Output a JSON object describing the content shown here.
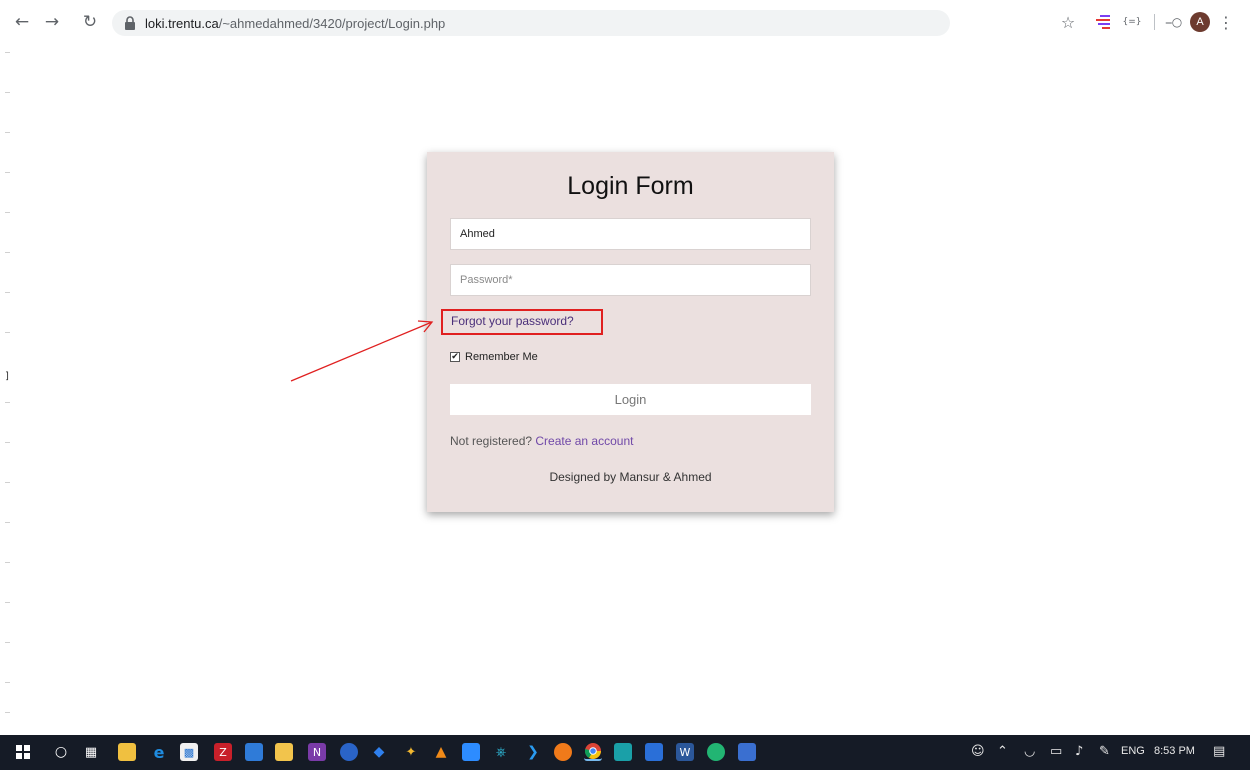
{
  "browser": {
    "url_host": "loki.trentu.ca",
    "url_path": "/~ahmedahmed/3420/project/Login.php",
    "avatar_letter": "A"
  },
  "form": {
    "title": "Login Form",
    "username_value": "Ahmed",
    "password_placeholder": "Password*",
    "forgot_link": "Forgot your password?",
    "remember_label": "Remember Me",
    "remember_checked": true,
    "login_button": "Login",
    "register_prefix": "Not registered?",
    "register_link": "Create an account",
    "footer": "Designed by Mansur & Ahmed"
  },
  "annotation": {
    "highlight_color": "#e02020",
    "target": "forgot-password-link"
  },
  "taskbar": {
    "language": "ENG",
    "time": "8:53 PM",
    "apps": [
      "windows-start",
      "search-cortana",
      "task-view",
      "file-explorer",
      "edge",
      "store",
      "filezilla",
      "sticky-notes",
      "paint",
      "onenote",
      "app-blue",
      "sourcetree",
      "app-bird",
      "vlc",
      "zoom",
      "app-network",
      "vscode",
      "firefox",
      "chrome",
      "app-teal",
      "app-chat",
      "word",
      "app-green",
      "app-blue2"
    ]
  },
  "colors": {
    "card_bg": "#ebe0df",
    "link": "#7048a8",
    "taskbar_bg": "#151b26"
  }
}
